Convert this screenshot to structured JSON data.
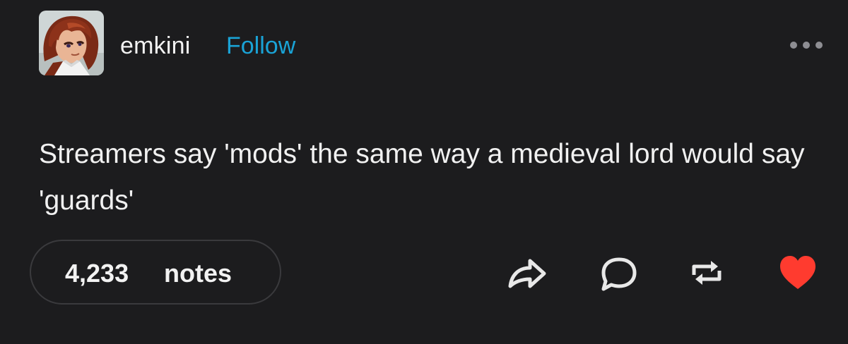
{
  "post": {
    "author": "emkini",
    "follow_label": "Follow",
    "text": "Streamers say 'mods' the same way a medieval lord would say 'guards'",
    "notes_count": "4,233",
    "notes_label": "notes",
    "liked": true
  },
  "icons": {
    "more": "more-horizontal-icon",
    "share": "share-icon",
    "reply": "reply-icon",
    "reblog": "reblog-icon",
    "like": "heart-icon"
  },
  "colors": {
    "background": "#1c1c1e",
    "follow": "#1aa3d6",
    "heart": "#ff3b2f"
  }
}
